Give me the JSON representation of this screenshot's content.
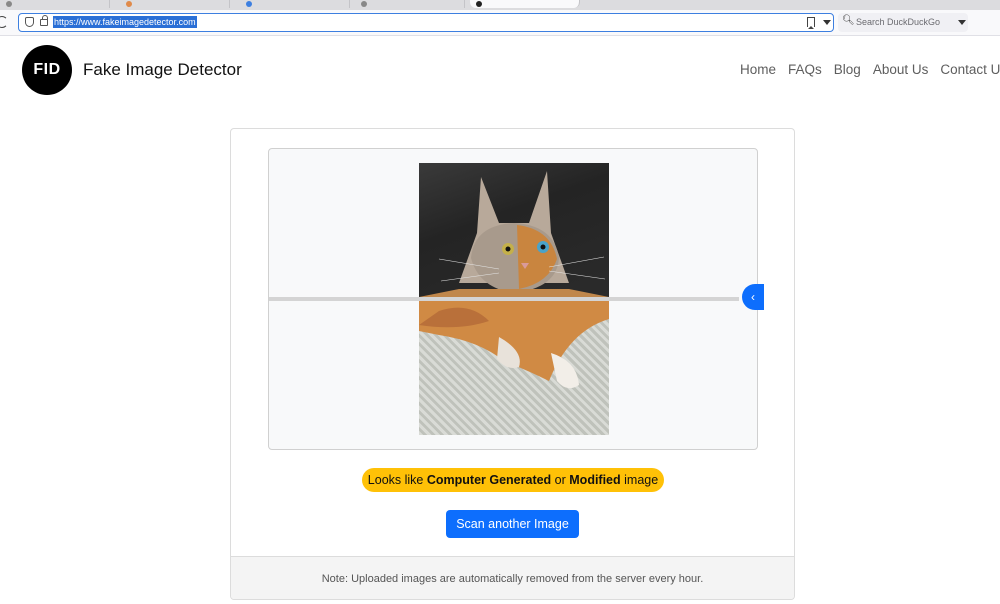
{
  "browser": {
    "url": "https://www.fakeimagedetector.com",
    "search_placeholder": "Search DuckDuckGo"
  },
  "site": {
    "logo_text": "FID",
    "brand": "Fake Image Detector",
    "nav": [
      "Home",
      "FAQs",
      "Blog",
      "About Us",
      "Contact Us"
    ]
  },
  "result": {
    "verdict_prefix": "Looks like ",
    "verdict_bold1": "Computer Generated",
    "verdict_mid": " or ",
    "verdict_bold2": "Modified",
    "verdict_suffix": " image",
    "verdict_color": "#ffc107"
  },
  "actions": {
    "scan_label": "Scan another Image",
    "accent": "#0d6efd"
  },
  "footer": {
    "note": "Note: Uploaded images are automatically removed from the server every hour."
  },
  "icons": {
    "slider_handle": "chevron-left-icon"
  }
}
